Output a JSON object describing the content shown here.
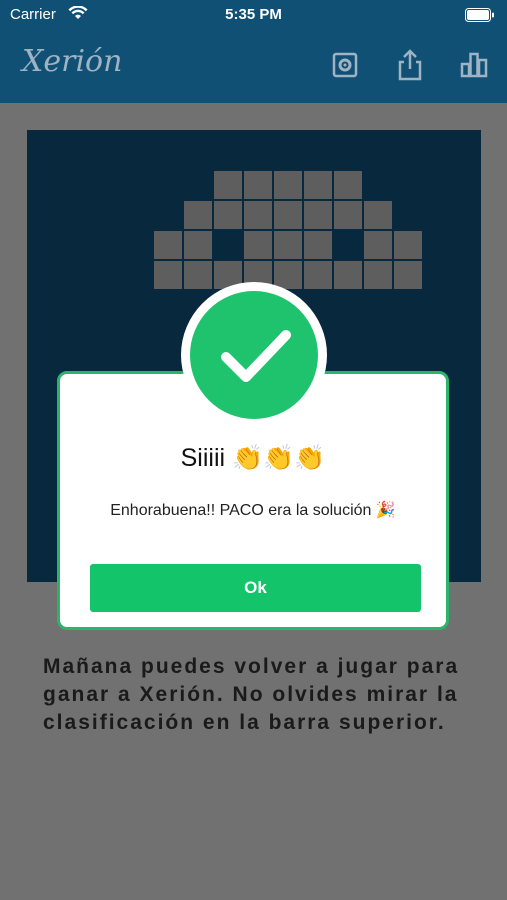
{
  "status_bar": {
    "carrier": "Carrier",
    "time": "5:35 PM"
  },
  "nav": {
    "logo": "Xerión",
    "icons": [
      "settings-icon",
      "share-icon",
      "leaderboard-icon"
    ],
    "bg_color": "#0f5074"
  },
  "board": {
    "bg_color": "#0c3d5b",
    "cell_color": "#8d8d8d"
  },
  "modal": {
    "title": "Siiiii 👏👏👏",
    "message": "Enhorabuena!! PACO era la solución 🎉",
    "ok_label": "Ok",
    "accent": "#14c46a",
    "badge_icon": "check-icon"
  },
  "bottom_text": "Mañana puedes volver a jugar para ganar a Xerión. No olvides mirar la clasificación en la barra superior."
}
